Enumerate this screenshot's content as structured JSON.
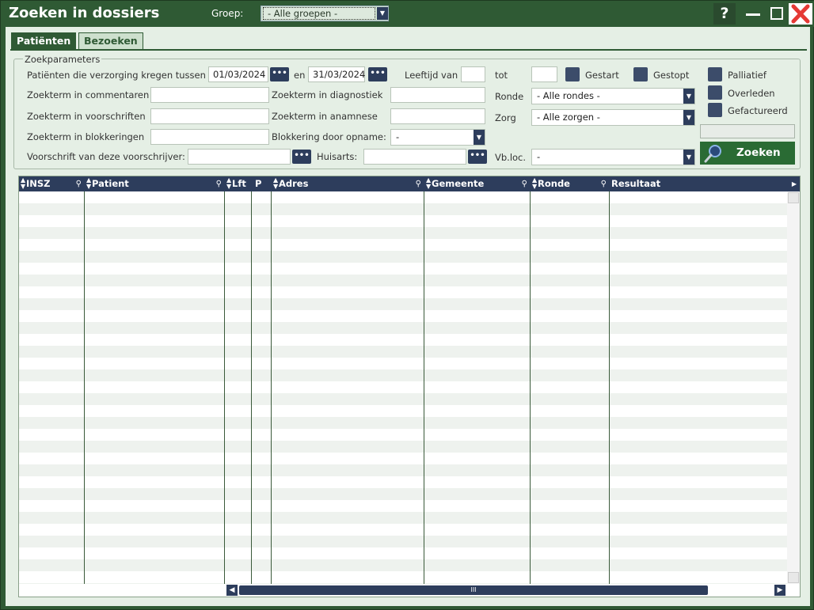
{
  "window": {
    "title": "Zoeken in dossiers",
    "groep_label": "Groep:",
    "groep_value": "- Alle groepen -",
    "help_label": "?"
  },
  "tabs": [
    {
      "label": "Patiënten",
      "active": true
    },
    {
      "label": "Bezoeken",
      "active": false
    }
  ],
  "search": {
    "legend": "Zoekparameters",
    "verzorging_label": "Patiënten die verzorging kregen tussen",
    "date_from": "01/03/2024",
    "en_label": "en",
    "date_to": "31/03/2024",
    "leeftijd_van_label": "Leeftijd van",
    "leeftijd_van_value": "",
    "tot_label": "tot",
    "tot_value": "",
    "gestart_label": "Gestart",
    "gestopt_label": "Gestopt",
    "palliatief_label": "Palliatief",
    "overleden_label": "Overleden",
    "gefactureerd_label": "Gefactureerd",
    "commentaren_label": "Zoekterm in commentaren",
    "commentaren_value": "",
    "diagnostiek_label": "Zoekterm in diagnostiek",
    "diagnostiek_value": "",
    "ronde_label": "Ronde",
    "ronde_value": "- Alle rondes -",
    "voorschriften_label": "Zoekterm in voorschriften",
    "voorschriften_value": "",
    "anamnese_label": "Zoekterm in anamnese",
    "anamnese_value": "",
    "zorg_label": "Zorg",
    "zorg_value": "- Alle zorgen -",
    "blokkeringen_label": "Zoekterm in blokkeringen",
    "blokkeringen_value": "",
    "blokkering_opname_label": "Blokkering door opname:",
    "blokkering_opname_value": "-",
    "voorschrijver_label": "Voorschrift van deze voorschrijver:",
    "voorschrijver_value": "",
    "huisarts_label": "Huisarts:",
    "huisarts_value": "",
    "vbloc_label": "Vb.loc.",
    "vbloc_value": "-",
    "dots_label": "•••",
    "zoeken_label": "Zoeken"
  },
  "grid": {
    "columns": [
      {
        "label": "INSZ",
        "sortable": true,
        "searchable": true
      },
      {
        "label": "Patient",
        "sortable": true,
        "searchable": true
      },
      {
        "label": "Lft",
        "sortable": true,
        "searchable": false
      },
      {
        "label": "P",
        "sortable": false,
        "searchable": false
      },
      {
        "label": "Adres",
        "sortable": true,
        "searchable": true
      },
      {
        "label": "Gemeente",
        "sortable": true,
        "searchable": true
      },
      {
        "label": "Ronde",
        "sortable": true,
        "searchable": true
      },
      {
        "label": "Resultaat",
        "sortable": false,
        "searchable": false
      }
    ],
    "scroll_thumb_label": "III"
  }
}
